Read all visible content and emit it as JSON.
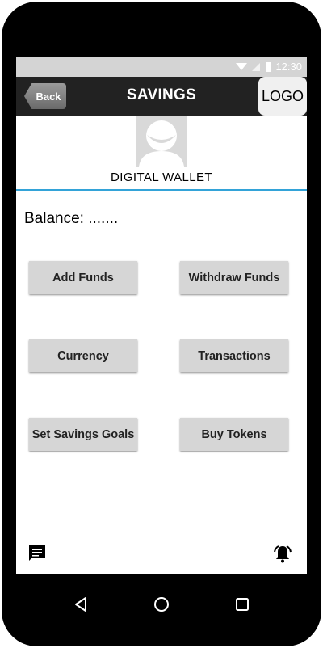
{
  "status_bar": {
    "time": "12:30",
    "icons": [
      "wifi-icon",
      "signal-icon",
      "battery-icon"
    ]
  },
  "app_bar": {
    "back_label": "Back",
    "title": "SAVINGS",
    "logo": "LOGO"
  },
  "profile": {
    "wallet_label": "DIGITAL WALLET"
  },
  "balance": {
    "text": "Balance: ......."
  },
  "actions": {
    "add_funds": "Add Funds",
    "withdraw_funds": "Withdraw Funds",
    "currency": "Currency",
    "transactions": "Transactions",
    "set_savings_goals": "Set Savings Goals",
    "buy_tokens": "Buy Tokens"
  },
  "colors": {
    "accent_divider": "#33a3d8",
    "app_bar_bg": "#222222",
    "button_bg": "#d6d6d6"
  }
}
